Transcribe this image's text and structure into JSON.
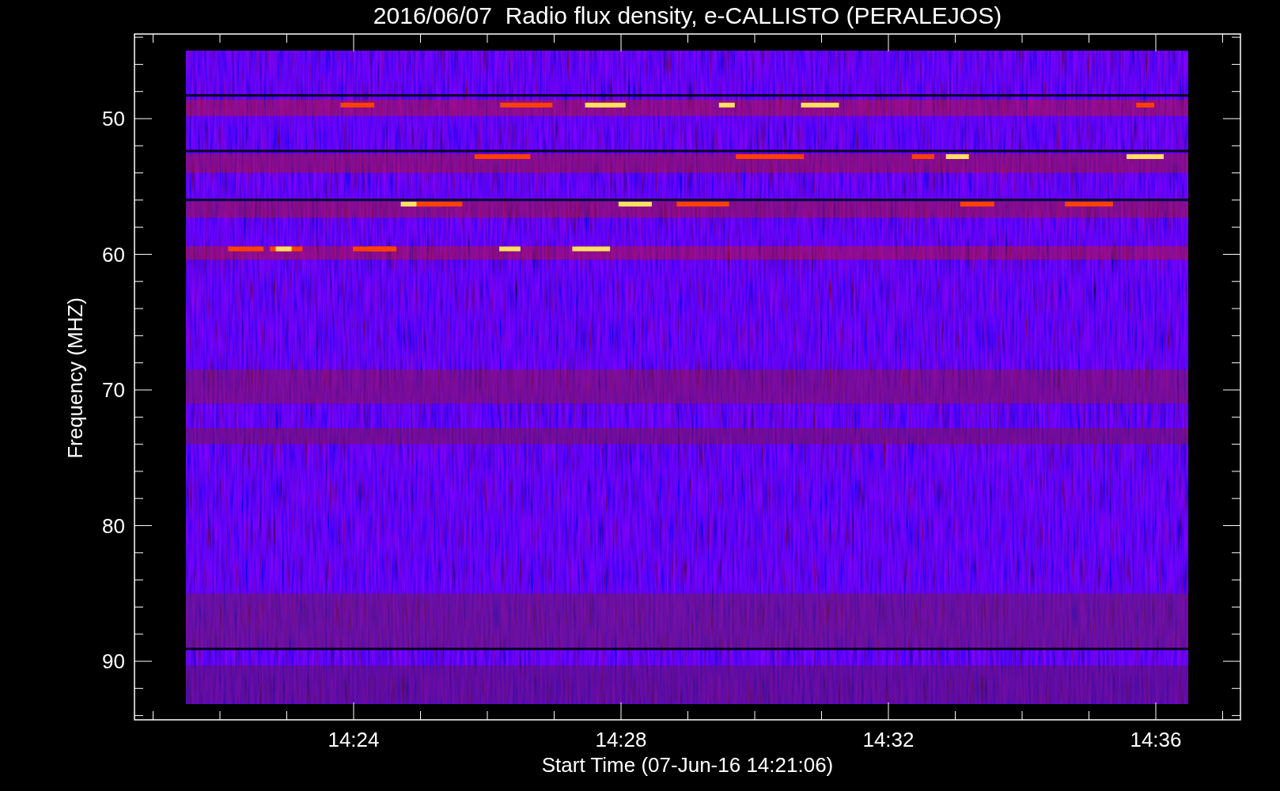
{
  "title": "2016/06/07  Radio flux density, e-CALLISTO (PERALEJOS)",
  "y_axis": {
    "label": "Frequency (MHZ)",
    "ticks": [
      "50",
      "60",
      "70",
      "80",
      "90"
    ]
  },
  "x_axis": {
    "label": "Start Time (07-Jun-16 14:21:06)",
    "ticks": [
      "14:24",
      "14:28",
      "14:32",
      "14:36"
    ]
  }
}
